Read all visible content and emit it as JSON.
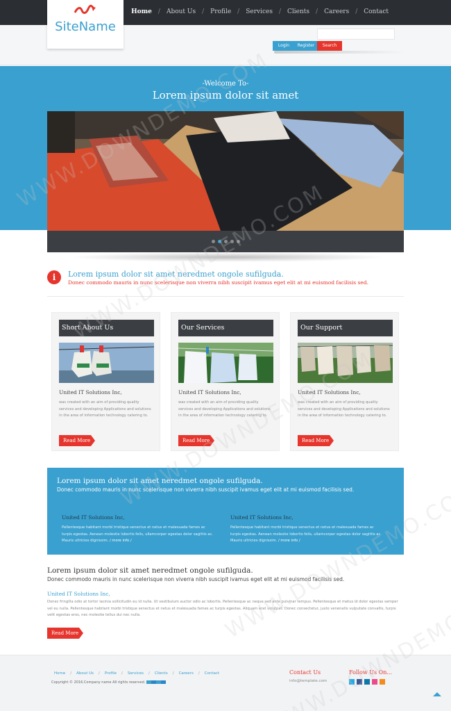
{
  "brand": {
    "site_name": "SiteName",
    "accent": "#3aa0cf",
    "red": "#e5352d",
    "dark": "#2b2f33"
  },
  "nav": {
    "items": [
      "Home",
      "About Us",
      "Profile",
      "Services",
      "Clients",
      "Careers",
      "Contact"
    ],
    "active": "Home"
  },
  "account": {
    "login": "Login",
    "register": "Register",
    "search": "Search"
  },
  "hero": {
    "welcome": "-Welcome To-",
    "title": "Lorem ipsum dolor sit amet",
    "slides": 5,
    "active_slide": 2
  },
  "info": {
    "title": "Lorem ipsum dolor sit amet neredmet ongole sufilguda.",
    "subtitle": "Donec commodo mauris in nunc scelerisque non viverra nibh suscipit ivamus eget elit at mi euismod facilisis sed."
  },
  "boxes": [
    {
      "heading": "Short About Us",
      "company": "United IT Solutions Inc,",
      "body": "was created with an aim of providing quality services and developing Applications and solutions in the area of information technology catering to.",
      "button": "Read More"
    },
    {
      "heading": "Our Services",
      "company": "United IT Solutions Inc,",
      "body": "was created with an aim of providing quality services and developing Applications and solutions in the area of information technology catering to.",
      "button": "Read More"
    },
    {
      "heading": "Our Support",
      "company": "United IT Solutions Inc,",
      "body": "was created with an aim of providing quality services and developing Applications and solutions in the area of information technology catering to.",
      "button": "Read More"
    }
  ],
  "band": {
    "title": "Lorem ipsum dolor sit amet neredmet ongole sufilguda.",
    "subtitle": "Donec commodo mauris in nunc scelerisque non viverra nibh suscipit ivamus eget elit at mi euismod facilisis sed.",
    "columns": [
      {
        "company": "United IT Solutions Inc,",
        "body": "Pellentesque habitant morbi tristique senectus et netus et malesuada fames ac turpis egestas. Aenean molestie lobortis felis, ullamcorper egestas dolor sagittis ac. Mauris ultricies dignissim.",
        "more": "/ more info /"
      },
      {
        "company": "United IT Solutions Inc,",
        "body": "Pellentesque habitant morbi tristique senectus et netus et malesuada fames ac turpis egestas. Aenean molestie lobortis felis, ullamcorper egestas dolor sagittis ac. Mauris ultricies dignissim.",
        "more": "/ more info /"
      }
    ]
  },
  "bottom": {
    "title": "Lorem ipsum dolor sit amet neredmet ongole sufilguda.",
    "subtitle": "Donec commodo mauris in nunc scelerisque non viverra nibh suscipit ivamus eget elit at mi euismod facilisis sed.",
    "company": "United IT Solutions Inc,",
    "body": "Donec fringilla odio at tortor lacinia sollicitudin eu id nulla. Ut vestibulum auctor odio ac lobortis. Pellentesque ac neque sed ante pulvinar tempus. Pellentesque et metus id dolor egestas semper vel eu nulla. Pellentesque habitant morbi tristique senectus et netus et malesuada fames ac turpis egestas. Aliquam erat volutpat. Donec consectetur, justo venenatis vulputate convallis, turpis velit egestas eros, nec molestie tellus dui nec nulla.",
    "button": "Read More"
  },
  "footer": {
    "nav": [
      "Home",
      "About Us",
      "Profile",
      "Services",
      "Clients",
      "Careers",
      "Contact"
    ],
    "copyright": "Copyright © 2016.Company name All rights reserved.",
    "contact_title": "Contact Us",
    "contact_email": "info@template.com",
    "follow_title": "Follow Us On...",
    "social_icons": [
      "twitter-icon",
      "facebook-icon",
      "linkedin-icon",
      "dribbble-icon",
      "rss-icon"
    ]
  }
}
